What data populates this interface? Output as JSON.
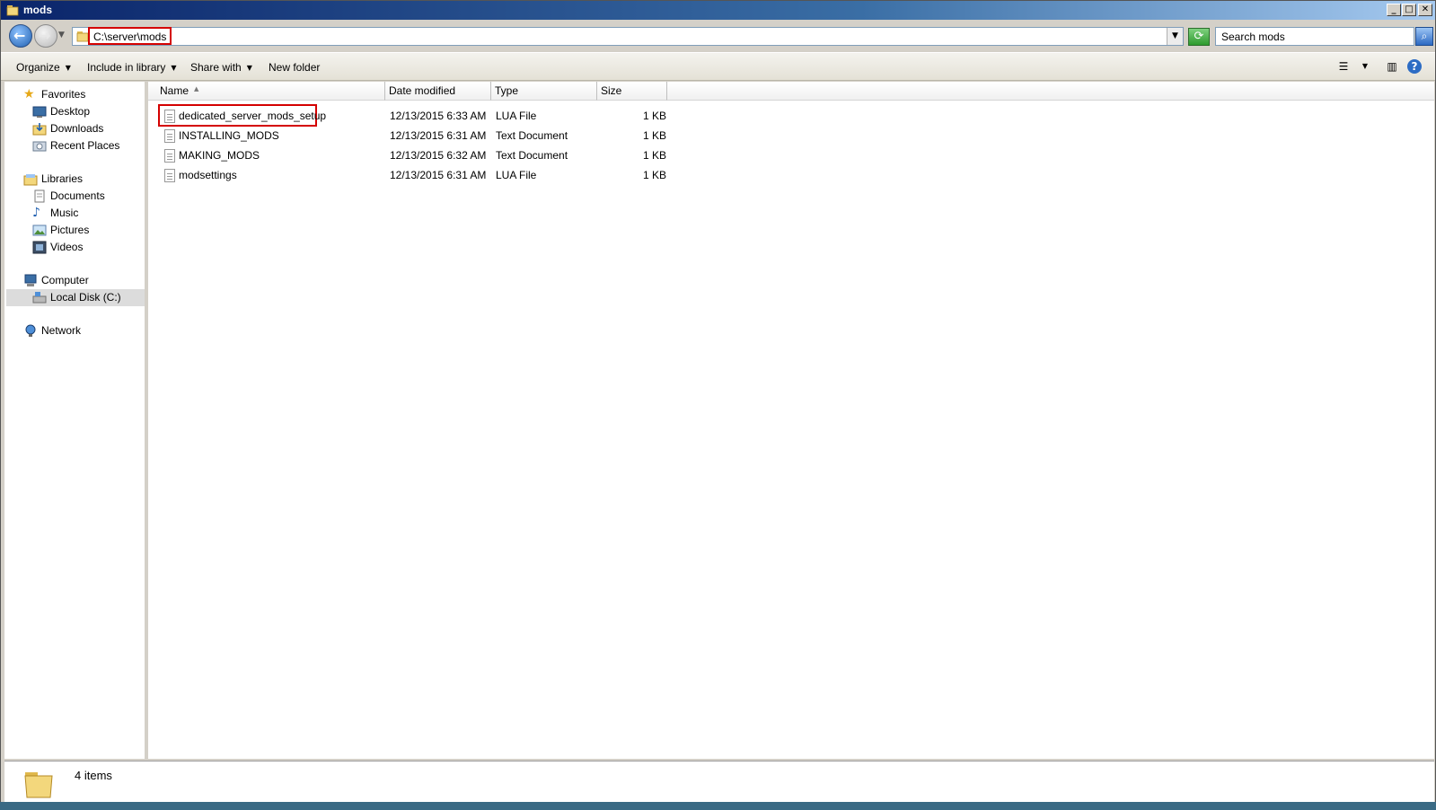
{
  "window": {
    "title": "mods"
  },
  "address": {
    "path": "C:\\server\\mods",
    "search_placeholder": "Search mods"
  },
  "toolbar": {
    "organize": "Organize",
    "include_in_library": "Include in library",
    "share_with": "Share with",
    "new_folder": "New folder"
  },
  "nav": {
    "favorites": "Favorites",
    "desktop": "Desktop",
    "downloads": "Downloads",
    "recent_places": "Recent Places",
    "libraries": "Libraries",
    "documents": "Documents",
    "music": "Music",
    "pictures": "Pictures",
    "videos": "Videos",
    "computer": "Computer",
    "local_disk": "Local Disk (C:)",
    "network": "Network"
  },
  "columns": {
    "name": "Name",
    "date_modified": "Date modified",
    "type": "Type",
    "size": "Size"
  },
  "files": [
    {
      "name": "dedicated_server_mods_setup",
      "date": "12/13/2015 6:33 AM",
      "type": "LUA File",
      "size": "1 KB"
    },
    {
      "name": "INSTALLING_MODS",
      "date": "12/13/2015 6:31 AM",
      "type": "Text Document",
      "size": "1 KB"
    },
    {
      "name": "MAKING_MODS",
      "date": "12/13/2015 6:32 AM",
      "type": "Text Document",
      "size": "1 KB"
    },
    {
      "name": "modsettings",
      "date": "12/13/2015 6:31 AM",
      "type": "LUA File",
      "size": "1 KB"
    }
  ],
  "status": {
    "item_count": "4 items"
  },
  "colors": {
    "highlight": "#d40000",
    "titlebar_start": "#0a246a",
    "titlebar_end": "#a6caf0"
  }
}
